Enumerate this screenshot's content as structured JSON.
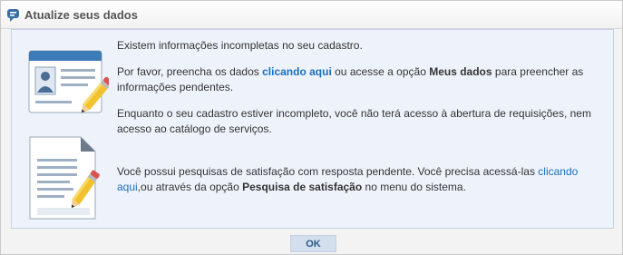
{
  "dialog": {
    "title": "Atualize seus dados",
    "title_icon": "chat-bubble-icon"
  },
  "messages": {
    "incomplete": "Existem informações incompletas no seu cadastro.",
    "fill_prefix": "Por favor, preencha os dados ",
    "fill_link": "clicando aqui",
    "fill_middle": " ou acesse a opção ",
    "fill_option": "Meus dados",
    "fill_suffix": " para preencher as informações pendentes.",
    "no_access": "Enquanto o seu cadastro estiver incompleto, você não terá acesso à abertura de requisições, nem acesso ao catálogo de serviços.",
    "survey_prefix": "Você possui pesquisas de satisfação com resposta pendente. Você precisa acessá-las ",
    "survey_link": "clicando aqui",
    "survey_middle": ",ou através da opção ",
    "survey_option": "Pesquisa de satisfação",
    "survey_suffix": " no menu do sistema."
  },
  "icons": {
    "profile": "id-card-pencil-icon",
    "survey": "document-pencil-icon"
  },
  "buttons": {
    "ok": "OK"
  },
  "colors": {
    "link": "#1a6fc4",
    "panel_bg": "#eef3fb",
    "button_bg": "#d3dfec"
  }
}
